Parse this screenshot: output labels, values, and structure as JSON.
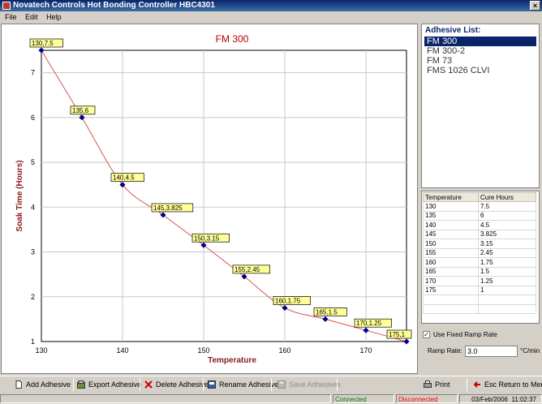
{
  "window": {
    "title": "Novatech Controls Hot Bonding Controller HBC4301",
    "close_glyph": "×"
  },
  "menu": [
    "File",
    "Edit",
    "Help"
  ],
  "adhesive_list": {
    "title": "Adhesive List:",
    "items": [
      "FM 300",
      "FM 300-2",
      "FM 73",
      "FMS 1026 CLVI"
    ],
    "selected_index": 0
  },
  "cure_table": {
    "headers": [
      "Temperature",
      "Cure Hours"
    ],
    "rows": [
      [
        "130",
        "7.5"
      ],
      [
        "135",
        "6"
      ],
      [
        "140",
        "4.5"
      ],
      [
        "145",
        "3.825"
      ],
      [
        "150",
        "3.15"
      ],
      [
        "155",
        "2.45"
      ],
      [
        "160",
        "1.75"
      ],
      [
        "165",
        "1.5"
      ],
      [
        "170",
        "1.25"
      ],
      [
        "175",
        "1"
      ]
    ]
  },
  "ramp": {
    "fixed_label": "Use Fixed Ramp Rate",
    "fixed_checked": true,
    "check_glyph": "✓",
    "rate_label": "Ramp Rate:",
    "rate_value": "3.0",
    "rate_unit": "°C/min"
  },
  "toolbar": {
    "add": "Add Adhesive",
    "export": "Export Adhesive",
    "delete": "Delete Adhesive",
    "rename": "Rename Adhesive",
    "save": "Save Adhesives",
    "print": "Print",
    "exit": "Esc Return to Menu"
  },
  "status": {
    "connected": "Connected",
    "disconnected": "Disconnected",
    "date": "03/Feb/2006",
    "time": "11:02:37"
  },
  "colors": {
    "title_text": "#b00000",
    "axis_label": "#8b1a1a",
    "curve": "#d9534f",
    "point": "#00008b",
    "label_bg": "#ffff99",
    "connected": "#008000",
    "disconnected": "#ff0000"
  },
  "chart_data": {
    "type": "scatter",
    "title": "FM 300",
    "xlabel": "Temperature",
    "ylabel": "Soak Time (Hours)",
    "xlim": [
      130,
      175
    ],
    "ylim": [
      1,
      7.5
    ],
    "xticks": [
      130,
      140,
      150,
      160,
      170
    ],
    "yticks": [
      1,
      2,
      3,
      4,
      5,
      6,
      7
    ],
    "grid": true,
    "trendline": true,
    "x": [
      130,
      135,
      140,
      145,
      150,
      155,
      160,
      165,
      170,
      175
    ],
    "y": [
      7.5,
      6,
      4.5,
      3.825,
      3.15,
      2.45,
      1.75,
      1.5,
      1.25,
      1
    ],
    "labels": [
      "130,7.5",
      "135,6",
      "140,4.5",
      "145,3.825",
      "150,3.15",
      "155,2.45",
      "160,1.75",
      "165,1.5",
      "170,1.25",
      "175,1"
    ]
  }
}
